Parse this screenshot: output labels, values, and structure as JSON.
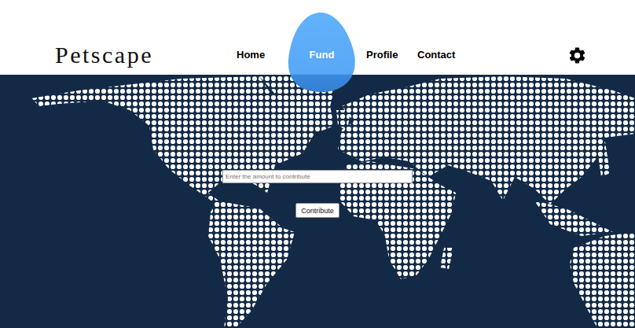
{
  "logo": "Petscape",
  "nav": [
    {
      "label": "Home",
      "selected": false
    },
    {
      "label": "Fund",
      "selected": true
    },
    {
      "label": "Profile",
      "selected": false
    },
    {
      "label": "Contact",
      "selected": false
    }
  ],
  "contribute": {
    "placeholder": "Enter the amount to contribute",
    "button": "Contribute"
  }
}
